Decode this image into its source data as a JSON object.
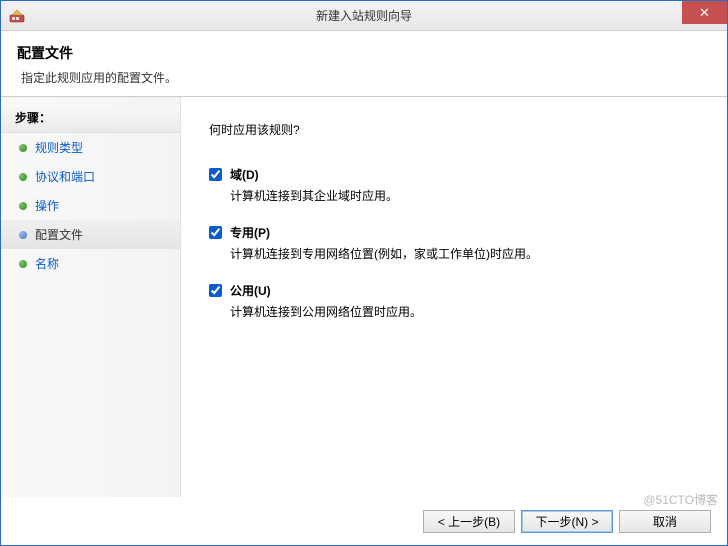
{
  "window": {
    "title": "新建入站规则向导"
  },
  "header": {
    "title": "配置文件",
    "subtitle": "指定此规则应用的配置文件。"
  },
  "sidebar": {
    "heading": "步骤：",
    "items": [
      {
        "label": "规则类型",
        "current": false
      },
      {
        "label": "协议和端口",
        "current": false
      },
      {
        "label": "操作",
        "current": false
      },
      {
        "label": "配置文件",
        "current": true
      },
      {
        "label": "名称",
        "current": false
      }
    ]
  },
  "main": {
    "question": "何时应用该规则?",
    "options": [
      {
        "label": "域(D)",
        "desc": "计算机连接到其企业域时应用。",
        "checked": true
      },
      {
        "label": "专用(P)",
        "desc": "计算机连接到专用网络位置(例如，家或工作单位)时应用。",
        "checked": true
      },
      {
        "label": "公用(U)",
        "desc": "计算机连接到公用网络位置时应用。",
        "checked": true
      }
    ]
  },
  "footer": {
    "back": "< 上一步(B)",
    "next": "下一步(N) >",
    "cancel": "取消"
  },
  "watermark": "@51CTO博客"
}
